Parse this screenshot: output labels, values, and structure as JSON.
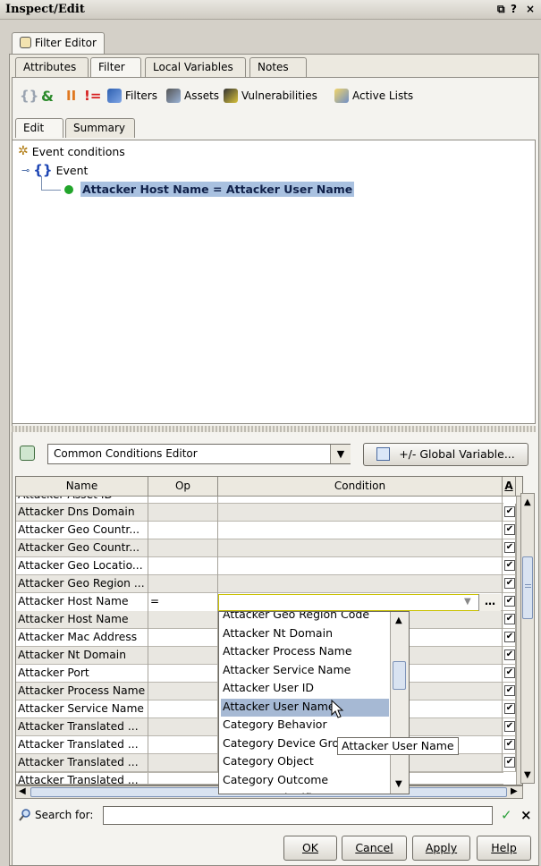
{
  "window": {
    "title": "Inspect/Edit",
    "controls": [
      "⧉",
      "?",
      "×"
    ]
  },
  "top_tab": {
    "label": "Filter Editor"
  },
  "tabs": [
    "Attributes",
    "Filter",
    "Local Variables",
    "Notes"
  ],
  "toolbar": {
    "items": [
      {
        "icon": "curly-braces-icon"
      },
      {
        "icon": "and-icon",
        "glyph": "&"
      },
      {
        "icon": "or-icon",
        "glyph": "II"
      },
      {
        "icon": "not-equal-icon",
        "glyph": "!="
      },
      {
        "icon": "filter-icon",
        "label": "Filters"
      },
      {
        "icon": "asset-icon",
        "label": "Assets"
      },
      {
        "icon": "vulnerability-icon",
        "label": "Vulnerabilities"
      },
      {
        "icon": "active-list-icon",
        "label": "Active Lists"
      }
    ]
  },
  "subtabs": [
    "Edit",
    "Summary"
  ],
  "tree": {
    "root": "Event conditions",
    "group": "Event",
    "condition": "Attacker Host Name = Attacker User Name"
  },
  "editor": {
    "select_value": "Common Conditions Editor",
    "global_button": "+/- Global Variable..."
  },
  "grid": {
    "headers": {
      "name": "Name",
      "op": "Op",
      "condition": "Condition",
      "last": "A"
    },
    "partial_top_row": "Attacker Asset ID",
    "rows": [
      {
        "name": "Attacker Dns Domain",
        "op": "",
        "checked": true
      },
      {
        "name": "Attacker Geo Countr...",
        "op": "",
        "checked": true
      },
      {
        "name": "Attacker Geo Countr...",
        "op": "",
        "checked": true
      },
      {
        "name": "Attacker Geo Locatio...",
        "op": "",
        "checked": true
      },
      {
        "name": "Attacker Geo Region ...",
        "op": "",
        "checked": true
      },
      {
        "name": "Attacker Host Name",
        "op": "=",
        "checked": true,
        "active": true
      },
      {
        "name": "Attacker Host Name",
        "op": "",
        "checked": true
      },
      {
        "name": "Attacker Mac Address",
        "op": "",
        "checked": true
      },
      {
        "name": "Attacker Nt Domain",
        "op": "",
        "checked": true
      },
      {
        "name": "Attacker Port",
        "op": "",
        "checked": true
      },
      {
        "name": "Attacker Process Name",
        "op": "",
        "checked": true
      },
      {
        "name": "Attacker Service Name",
        "op": "",
        "checked": true
      },
      {
        "name": "Attacker Translated ...",
        "op": "",
        "checked": true
      },
      {
        "name": "Attacker Translated ...",
        "op": "",
        "checked": true
      },
      {
        "name": "Attacker Translated ...",
        "op": "",
        "checked": true
      }
    ],
    "partial_bottom_row": "Attacker Translated ..."
  },
  "dropdown": {
    "items": [
      "Attacker Geo Region Code",
      "Attacker Nt Domain",
      "Attacker Process Name",
      "Attacker Service Name",
      "Attacker User ID",
      "Attacker User Name",
      "Category Behavior",
      "Category Device Group",
      "Category Object",
      "Category Outcome",
      "Category Significance"
    ],
    "selected_index": 5,
    "tooltip": "Attacker User Name"
  },
  "search": {
    "label": "Search for:",
    "value": ""
  },
  "buttons": {
    "ok": "OK",
    "cancel": "Cancel",
    "apply": "Apply",
    "help": "Help"
  }
}
